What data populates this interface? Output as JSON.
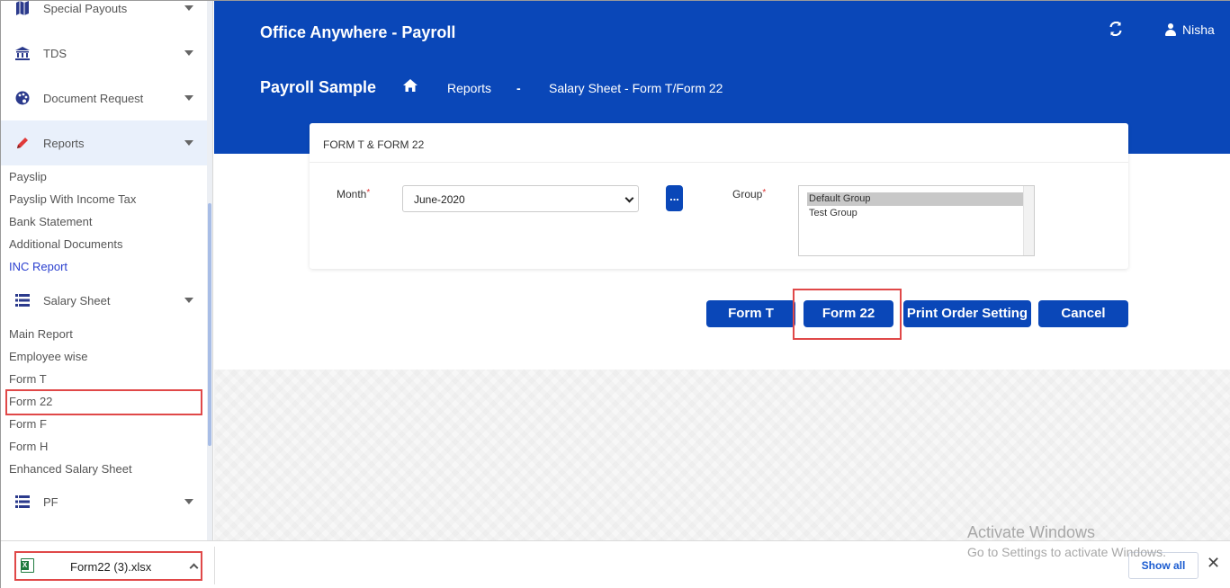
{
  "sidebar": {
    "menus": [
      {
        "label": "Special Payouts",
        "icon": "map-icon"
      },
      {
        "label": "TDS",
        "icon": "bank-icon"
      },
      {
        "label": "Document Request",
        "icon": "palette-icon"
      },
      {
        "label": "Reports",
        "icon": "pencil-icon"
      },
      {
        "label": "Salary Sheet",
        "icon": "list-icon"
      },
      {
        "label": "PF",
        "icon": "list-icon"
      }
    ],
    "reports_items": [
      "Payslip",
      "Payslip With Income Tax",
      "Bank Statement",
      "Additional Documents",
      "INC Report"
    ],
    "salary_items": [
      "Main Report",
      "Employee wise",
      "Form T",
      "Form 22",
      "Form F",
      "Form H",
      "Enhanced Salary Sheet"
    ]
  },
  "header": {
    "app_title": "Office Anywhere - Payroll",
    "user_name": "Nisha",
    "org_name": "Payroll Sample",
    "breadcrumb": {
      "section": "Reports",
      "separator": "-",
      "page": "Salary Sheet - Form T/Form 22"
    }
  },
  "form": {
    "title": "FORM T & FORM 22",
    "month_label": "Month",
    "month_value": "June-2020",
    "dots_label": "...",
    "group_label": "Group",
    "group_options": [
      "Default Group",
      "Test Group"
    ],
    "required_mark": "*"
  },
  "actions": {
    "form_t": "Form T",
    "form_22": "Form 22",
    "print_order": "Print Order Setting",
    "cancel": "Cancel"
  },
  "download_bar": {
    "file_name": "Form22 (3).xlsx",
    "show_all": "Show all",
    "close": "✕"
  },
  "watermark": {
    "line1": "Activate Windows",
    "line2": "Go to Settings to activate Windows."
  },
  "colors": {
    "primary": "#0a47b8",
    "highlight": "#e04848"
  }
}
